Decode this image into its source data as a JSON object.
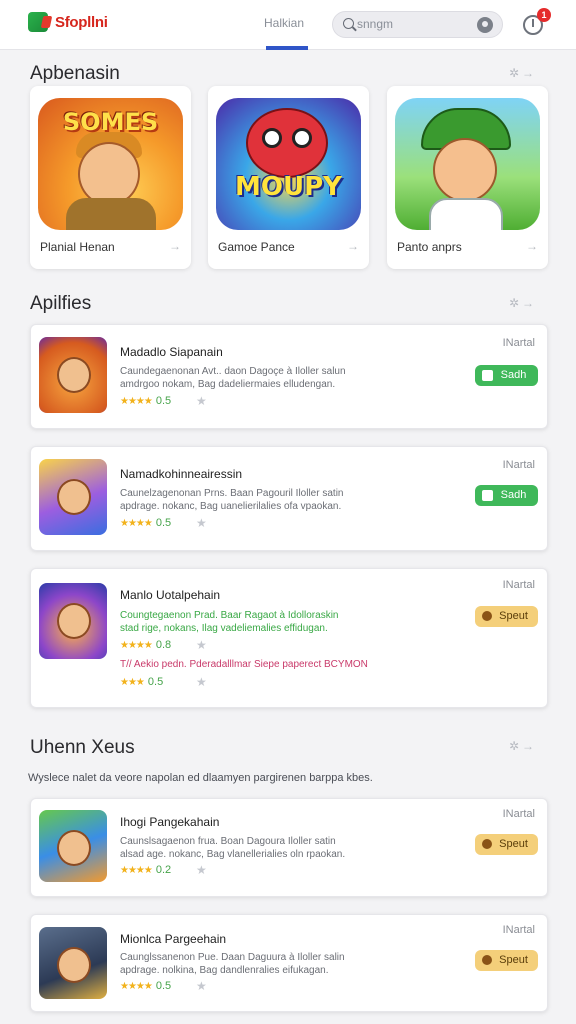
{
  "header": {
    "logo_text": "Sfopllni",
    "nav_tab": "Halkian",
    "search_placeholder": "snngm",
    "notification_count": "1"
  },
  "featured": {
    "title": "Apbenasin",
    "cards": [
      {
        "art_title": "SOMES",
        "label": "Planial Henan"
      },
      {
        "art_title": "MOUPY",
        "label": "Gamoe Pance"
      },
      {
        "art_title": "",
        "label": "Panto anprs"
      }
    ]
  },
  "apps_section": {
    "title": "Apilfies",
    "items": [
      {
        "name": "Madadlo Siapanain",
        "desc": "Caundegaenonan Avt.. daon Dagoçe à Iloller salun amdrgoo nokam, Bag dadeliermaies elludengan.",
        "rating": "0.5",
        "stars": "★★★★",
        "meta": "INartal",
        "button": "Sadh",
        "button_style": "green"
      },
      {
        "name": "Namadkohinneairessin",
        "desc": "Caunelzagenonan Prns. Baan Pagouril Iloller satin apdrage. nokanc, Bag uanelierilalies ofa vpaokan.",
        "rating": "0.5",
        "stars": "★★★★",
        "meta": "INartal",
        "button": "Sadh",
        "button_style": "green"
      },
      {
        "name": "Manlo Uotalpehain",
        "desc": "Coungtegaenon Prad. Baar Ragaot à Idolloraskin stad rige, nokans, Ilag vadeliemalies effidugan.",
        "desc_style": "green",
        "rating": "0.8",
        "stars": "★★★★",
        "rating_2": "0.5",
        "stars_2": "★★★",
        "promo": "T// Aekio pedn. Pderadalllmar Siepe paperect BCYMON",
        "meta": "INartal",
        "button": "Speut",
        "button_style": "amber"
      }
    ]
  },
  "news_section": {
    "title": "Uhenn Xeus",
    "description": "Wyslece nalet da veore napolan ed dlaamyen pargirenen barppa kbes.",
    "items": [
      {
        "name": "Ihogi Pangekahain",
        "desc": "Caunslsagaenon frua. Boan Dagoura Iloller satin alsad age. nokanc, Bag vlanellerialies oln rpaokan.",
        "rating": "0.2",
        "stars": "★★★★",
        "meta": "INartal",
        "button": "Speut",
        "button_style": "amber"
      },
      {
        "name": "Mionlca Pargeehain",
        "desc": "Caunglssanenon Pue. Daan Daguura à Iloller salin apdrage. nolkina, Bag dandlenralies eifukagan.",
        "rating": "0.5",
        "stars": "★★★★",
        "meta": "INartal",
        "button": "Speut",
        "button_style": "amber"
      }
    ]
  },
  "colors": {
    "accent": "#2f55c8",
    "brand": "#d6261d",
    "install_green": "#3fb85a",
    "update_amber": "#f4cf7a",
    "rating_green": "#46a34a",
    "star_gold": "#f2b21c"
  }
}
